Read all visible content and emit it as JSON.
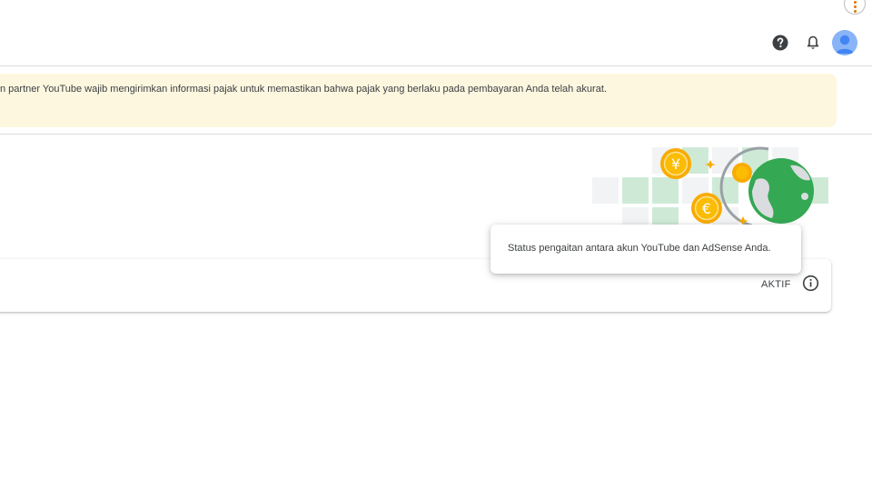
{
  "banner": {
    "text": "n partner YouTube wajib mengirimkan informasi pajak untuk memastikan bahwa pajak yang berlaku pada pembayaran Anda telah akurat."
  },
  "card": {
    "status": "AKTIF"
  },
  "tooltip": {
    "text": "Status pengaitan antara akun YouTube dan AdSense Anda."
  },
  "illustration": {
    "coin_yen_symbol": "¥",
    "coin_euro_symbol": "€"
  },
  "colors": {
    "banner_bg": "#fef7e0",
    "globe_green": "#34a853",
    "coin_gold": "#f9ab00",
    "tile_green": "#ceead6",
    "tile_gray": "#f1f3f4",
    "avatar_blue": "#8ab4f8"
  },
  "icons": [
    "more-vert-icon",
    "help-icon",
    "bell-icon",
    "avatar-icon",
    "info-icon",
    "globe-icon",
    "yen-coin-icon",
    "euro-coin-icon",
    "sparkle-icon"
  ]
}
